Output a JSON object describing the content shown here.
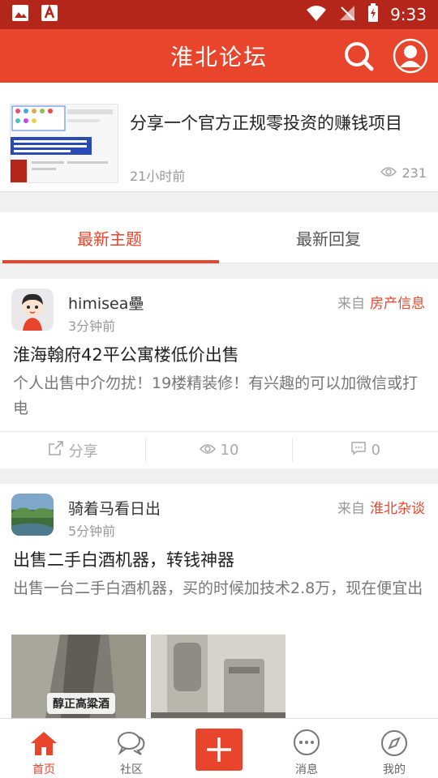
{
  "status_bar": {
    "time": "9:33"
  },
  "header": {
    "title": "淮北论坛"
  },
  "top_card": {
    "title": "分享一个官方正规零投资的赚钱项目",
    "time": "21小时前",
    "views": "231"
  },
  "tabs": [
    {
      "label": "最新主题",
      "active": true
    },
    {
      "label": "最新回复",
      "active": false
    }
  ],
  "posts": [
    {
      "username": "himisea壘",
      "time": "3分钟前",
      "from_label": "来自",
      "forum": "房产信息",
      "title": "淮海翰府42平公寓楼低价出售",
      "excerpt": "个人出售中介勿扰！19楼精装修！有兴趣的可以加微信或打电",
      "actions": {
        "share": "分享",
        "views": "10",
        "comments": "0"
      }
    },
    {
      "username": "骑着马看日出",
      "time": "5分钟前",
      "from_label": "来自",
      "forum": "淮北杂谈",
      "title": "出售二手白酒机器，转钱神器",
      "excerpt": "出售一台二手白酒机器，买的时候加技术2.8万，现在便宜出",
      "image_caption": "醇正高粱酒"
    }
  ],
  "bottom_nav": [
    {
      "label": "首页",
      "icon": "home-icon",
      "active": true
    },
    {
      "label": "社区",
      "icon": "chat-bubbles-icon",
      "active": false
    },
    {
      "label": "",
      "icon": "plus-icon",
      "active": false
    },
    {
      "label": "消息",
      "icon": "message-icon",
      "active": false
    },
    {
      "label": "我的",
      "icon": "compass-icon",
      "active": false
    }
  ],
  "colors": {
    "primary": "#e8452c",
    "status_bar": "#b5261a",
    "text_muted": "#999999"
  }
}
